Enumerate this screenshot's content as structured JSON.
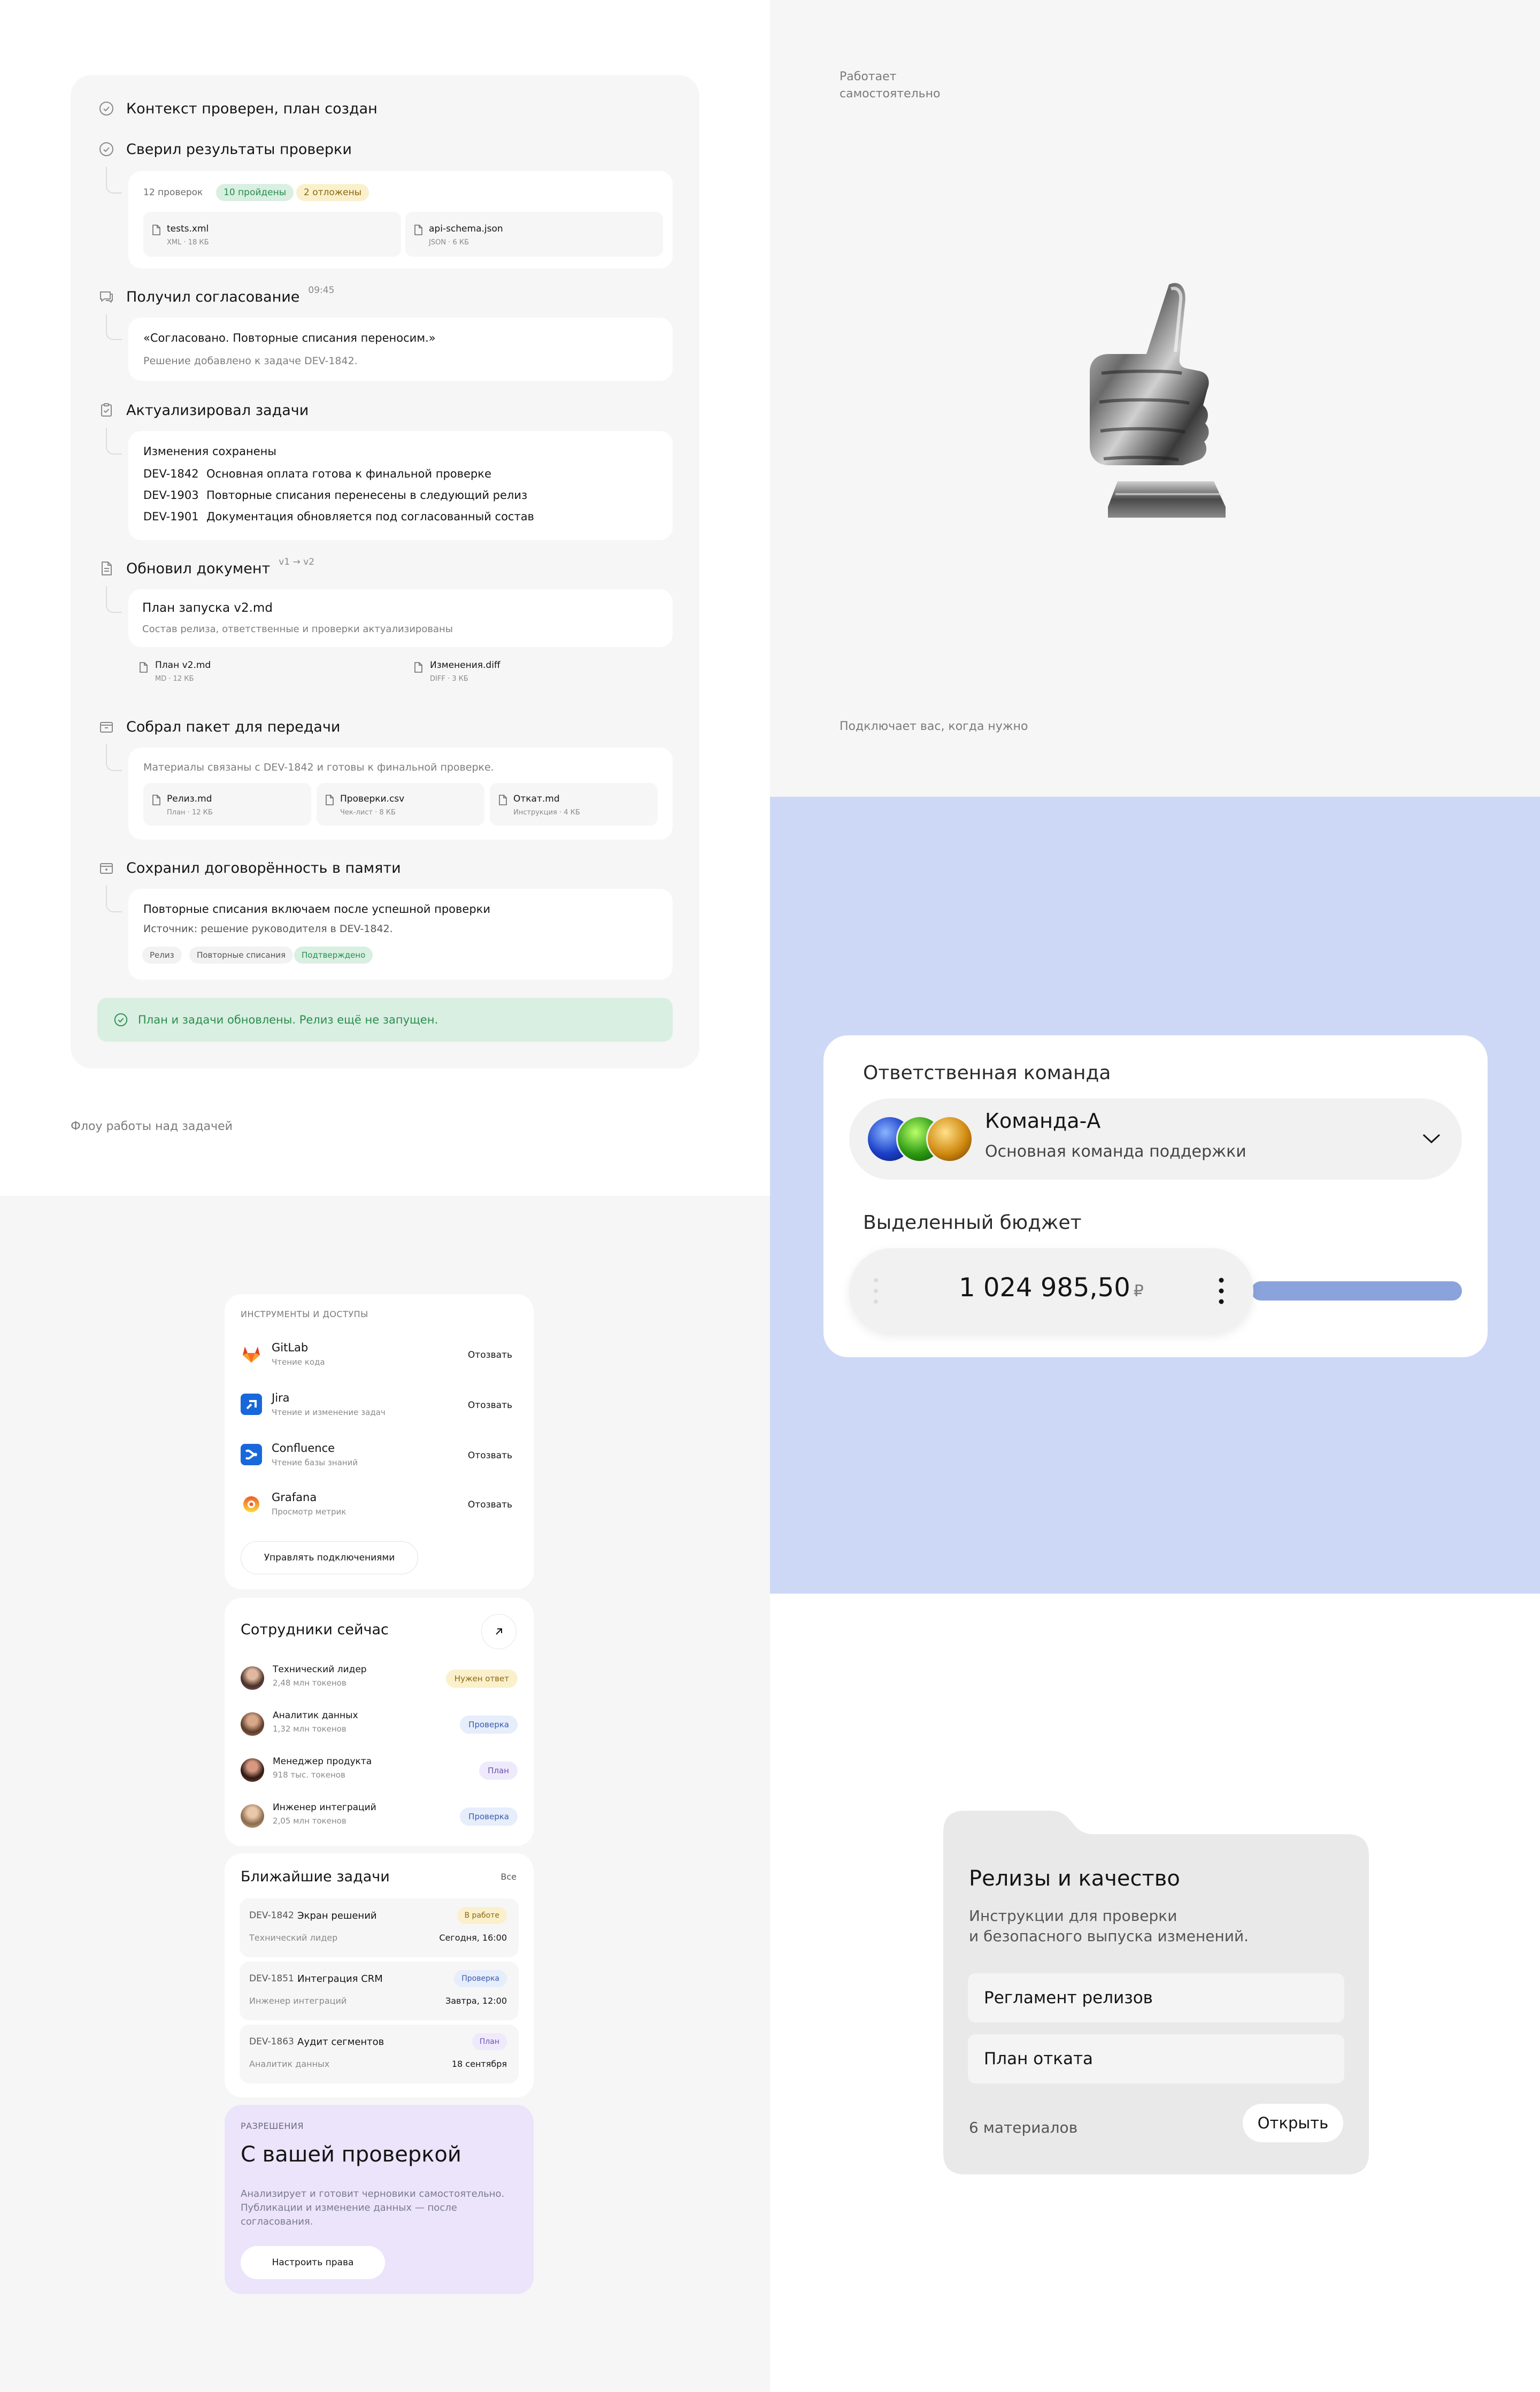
{
  "timeline": {
    "steps": [
      {
        "title": "Контекст проверен, план создан",
        "icon": "check-circle-icon"
      },
      {
        "title": "Сверил результаты проверки",
        "icon": "check-circle-icon"
      },
      {
        "title": "Получил согласование",
        "meta": "09:45",
        "icon": "chat-bubble-icon"
      },
      {
        "title": "Актуализировал задачи",
        "icon": "clipboard-check-icon"
      },
      {
        "title": "Обновил документ",
        "meta": "v1 → v2",
        "icon": "document-icon"
      },
      {
        "title": "Собрал пакет для передачи",
        "icon": "package-icon"
      },
      {
        "title": "Сохранил договорённость в памяти",
        "icon": "memory-box-icon"
      }
    ],
    "checks": {
      "total": "12 проверок",
      "passed": "10 пройдены",
      "postponed": "2 отложены",
      "files": [
        {
          "name": "tests.xml",
          "meta": "XML · 18 КБ"
        },
        {
          "name": "api-schema.json",
          "meta": "JSON · 6 КБ"
        }
      ]
    },
    "approval": {
      "quote": "«Согласовано. Повторные списания переносим.»",
      "note": "Решение добавлено к задаче DEV-1842."
    },
    "tasks": {
      "header": "Изменения сохранены",
      "rows": [
        {
          "code": "DEV-1842",
          "text": "Основная оплата готова к финальной проверке"
        },
        {
          "code": "DEV-1903",
          "text": "Повторные списания перенесены в следующий релиз"
        },
        {
          "code": "DEV-1901",
          "text": "Документация обновляется под согласованный состав"
        }
      ]
    },
    "document": {
      "title": "План запуска v2.md",
      "desc": "Состав релиза, ответственные и проверки актуализированы",
      "files": [
        {
          "name": "План v2.md",
          "meta": "MD · 12 КБ"
        },
        {
          "name": "Изменения.diff",
          "meta": "DIFF · 3 КБ"
        }
      ]
    },
    "package": {
      "desc": "Материалы связаны с DEV-1842 и готовы к финальной проверке.",
      "files": [
        {
          "name": "Релиз.md",
          "meta": "План · 12 КБ"
        },
        {
          "name": "Проверки.csv",
          "meta": "Чек-лист · 8 КБ"
        },
        {
          "name": "Откат.md",
          "meta": "Инструкция · 4 КБ"
        }
      ]
    },
    "memory": {
      "title": "Повторные списания включаем после успешной проверки",
      "source": "Источник: решение руководителя в DEV-1842.",
      "tags": [
        "Релиз",
        "Повторные списания",
        "Подтверждено"
      ]
    },
    "success": "План и задачи обновлены. Релиз ещё не запущен."
  },
  "captions": {
    "flow": "Флоу работы над задачей",
    "works_alone": "Работает самостоятельно",
    "connects": "Подключает вас, когда нужно"
  },
  "team_card": {
    "team_label": "Ответственная команда",
    "team_name": "Команда-А",
    "team_desc": "Основная команда поддержки",
    "budget_label": "Выделенный бюджет",
    "budget_amount": "1 024 985,50",
    "currency": "₽",
    "budget_fill": 0.65,
    "colors": {
      "accent": "#8aa3dc",
      "bg": "#cdd8f6"
    }
  },
  "tools": {
    "title": "ИНСТРУМЕНТЫ И ДОСТУПЫ",
    "items": [
      {
        "name": "GitLab",
        "desc": "Чтение кода",
        "action": "Отозвать",
        "icon": "gitlab-icon"
      },
      {
        "name": "Jira",
        "desc": "Чтение и изменение задач",
        "action": "Отозвать",
        "icon": "jira-icon"
      },
      {
        "name": "Confluence",
        "desc": "Чтение базы знаний",
        "action": "Отозвать",
        "icon": "confluence-icon"
      },
      {
        "name": "Grafana",
        "desc": "Просмотр метрик",
        "action": "Отозвать",
        "icon": "grafana-icon"
      }
    ],
    "manage": "Управлять подключениями"
  },
  "employees": {
    "title": "Сотрудники сейчас",
    "items": [
      {
        "role": "Технический лидер",
        "tokens": "2,48 млн токенов",
        "status": "Нужен ответ"
      },
      {
        "role": "Аналитик данных",
        "tokens": "1,32 млн токенов",
        "status": "Проверка"
      },
      {
        "role": "Менеджер продукта",
        "tokens": "918 тыс. токенов",
        "status": "План"
      },
      {
        "role": "Инженер интеграций",
        "tokens": "2,05 млн токенов",
        "status": "Проверка"
      }
    ]
  },
  "upcoming": {
    "title": "Ближайшие задачи",
    "all": "Все",
    "items": [
      {
        "id": "DEV-1842",
        "name": "Экран решений",
        "person": "Технический лидер",
        "status": "В работе",
        "date": "Сегодня, 16:00"
      },
      {
        "id": "DEV-1851",
        "name": "Интеграция CRM",
        "person": "Инженер интеграций",
        "status": "Проверка",
        "date": "Завтра, 12:00"
      },
      {
        "id": "DEV-1863",
        "name": "Аудит сегментов",
        "person": "Аналитик данных",
        "status": "План",
        "date": "18 сентября"
      }
    ]
  },
  "permissions": {
    "label": "РАЗРЕШЕНИЯ",
    "title": "С вашей проверкой",
    "desc1": "Анализирует и готовит черновики самостоятельно.",
    "desc2": "Публикации и изменение данных — после",
    "desc3": "согласования.",
    "button": "Настроить права"
  },
  "folder": {
    "title": "Релизы и качество",
    "desc1": "Инструкции для проверки",
    "desc2": "и безопасного выпуска изменений.",
    "items": [
      "Регламент релизов",
      "План отката"
    ],
    "count": "6 материалов",
    "open": "Открыть"
  }
}
